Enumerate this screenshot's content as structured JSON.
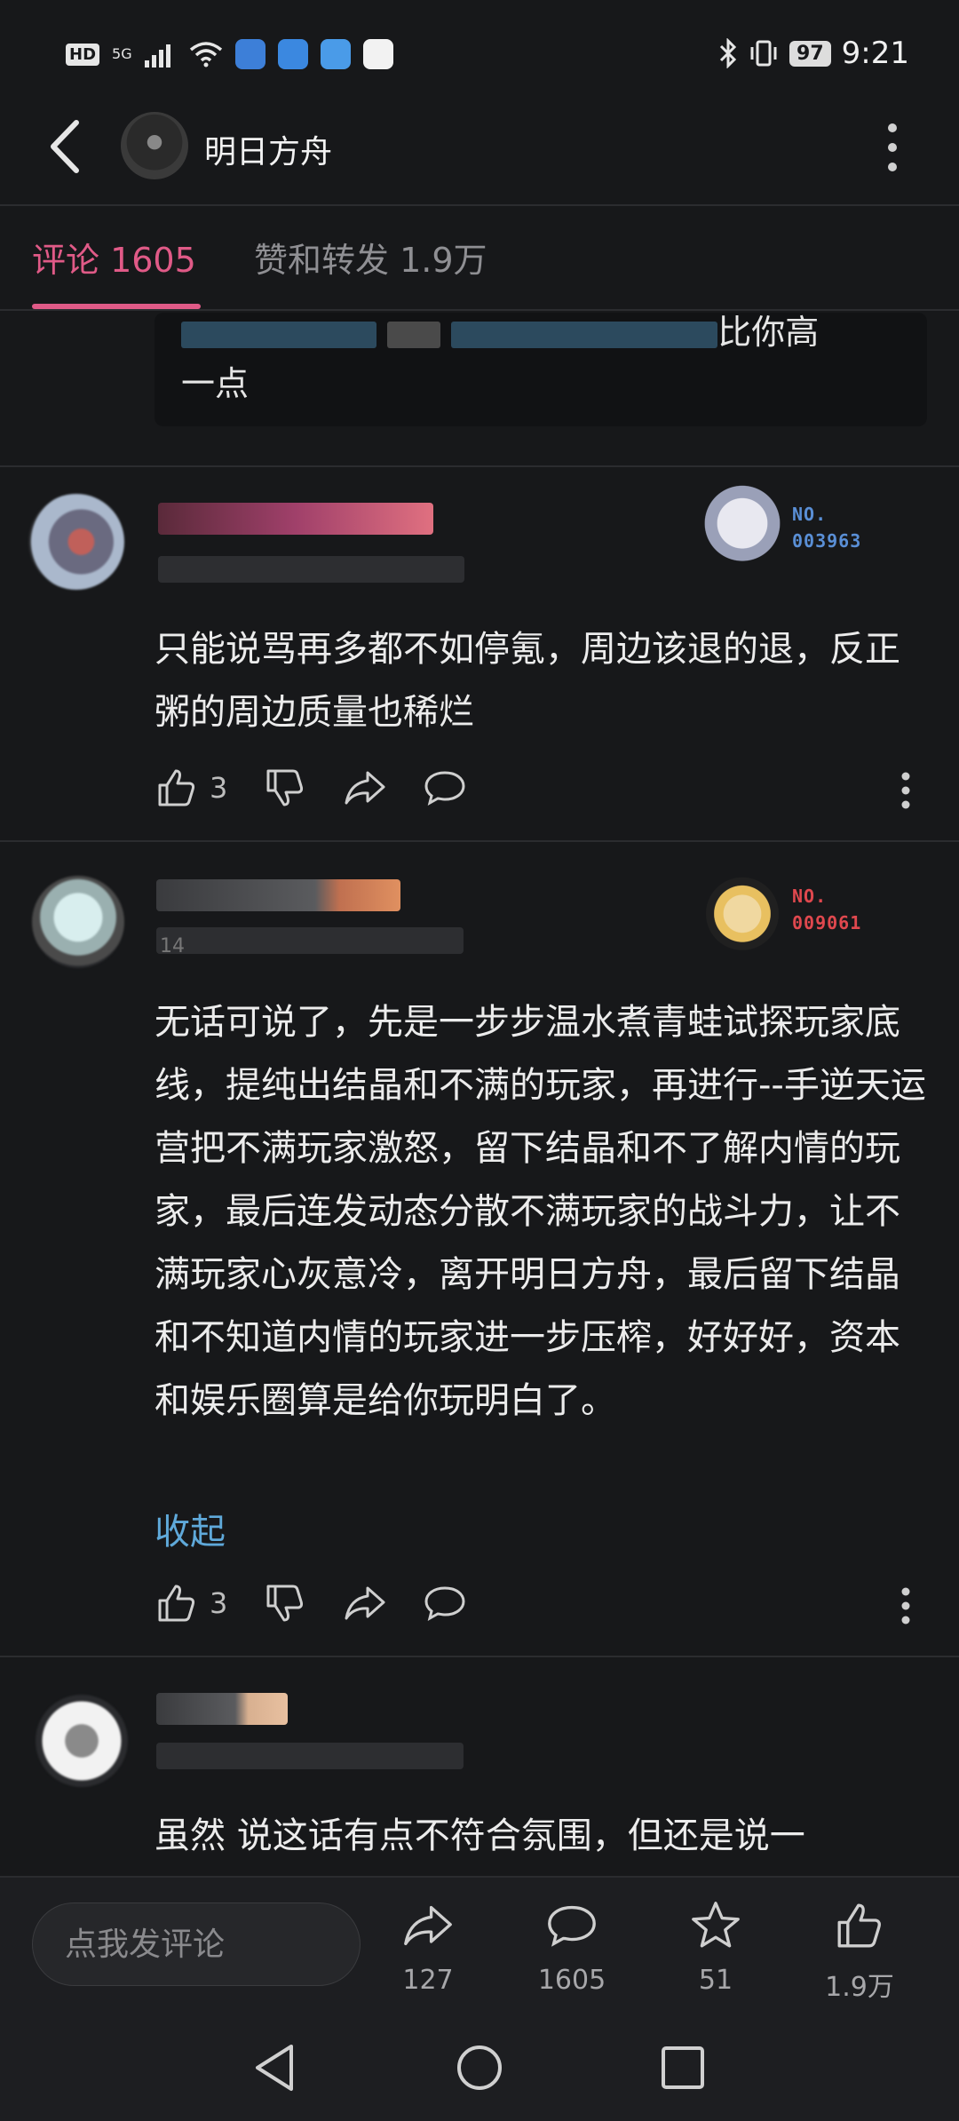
{
  "status_bar": {
    "hd": "HD",
    "signal": "5G",
    "battery": "97",
    "time": "9:21"
  },
  "header": {
    "title": "明日方舟"
  },
  "tabs": [
    {
      "label": "评论 1605",
      "active": true
    },
    {
      "label": "赞和转发 1.9万",
      "active": false
    }
  ],
  "reply_quote": {
    "text_line1": "比你高",
    "text_line2": "一点"
  },
  "comments": [
    {
      "badge_no_label": "NO.",
      "badge_no": "003963",
      "badge_color": "#5a8fd6",
      "text": "只能说骂再多都不如停氪，周边该退的退，反正粥的周边质量也稀烂",
      "likes": "3"
    },
    {
      "meta_visible": "14",
      "badge_no_label": "NO.",
      "badge_no": "009061",
      "badge_color": "#e0484e",
      "text": "无话可说了，先是一步步温水煮青蛙试探玩家底线，提纯出结晶和不满的玩家，再进行--手逆天运营把不满玩家激怒，留下结晶和不了解内情的玩家，最后连发动态分散不满玩家的战斗力，让不满玩家心灰意冷，离开明日方舟，最后留下结晶和不知道内情的玩家进一步压榨，好好好，资本和娱乐圈算是给你玩明白了。",
      "collapse_label": "收起",
      "likes": "3"
    },
    {
      "text": "虽然 说这话有点不符合氛围，但还是说一"
    }
  ],
  "bottom_bar": {
    "input_placeholder": "点我发评论",
    "share_count": "127",
    "comment_count": "1605",
    "favorite_count": "51",
    "like_count": "1.9万"
  }
}
